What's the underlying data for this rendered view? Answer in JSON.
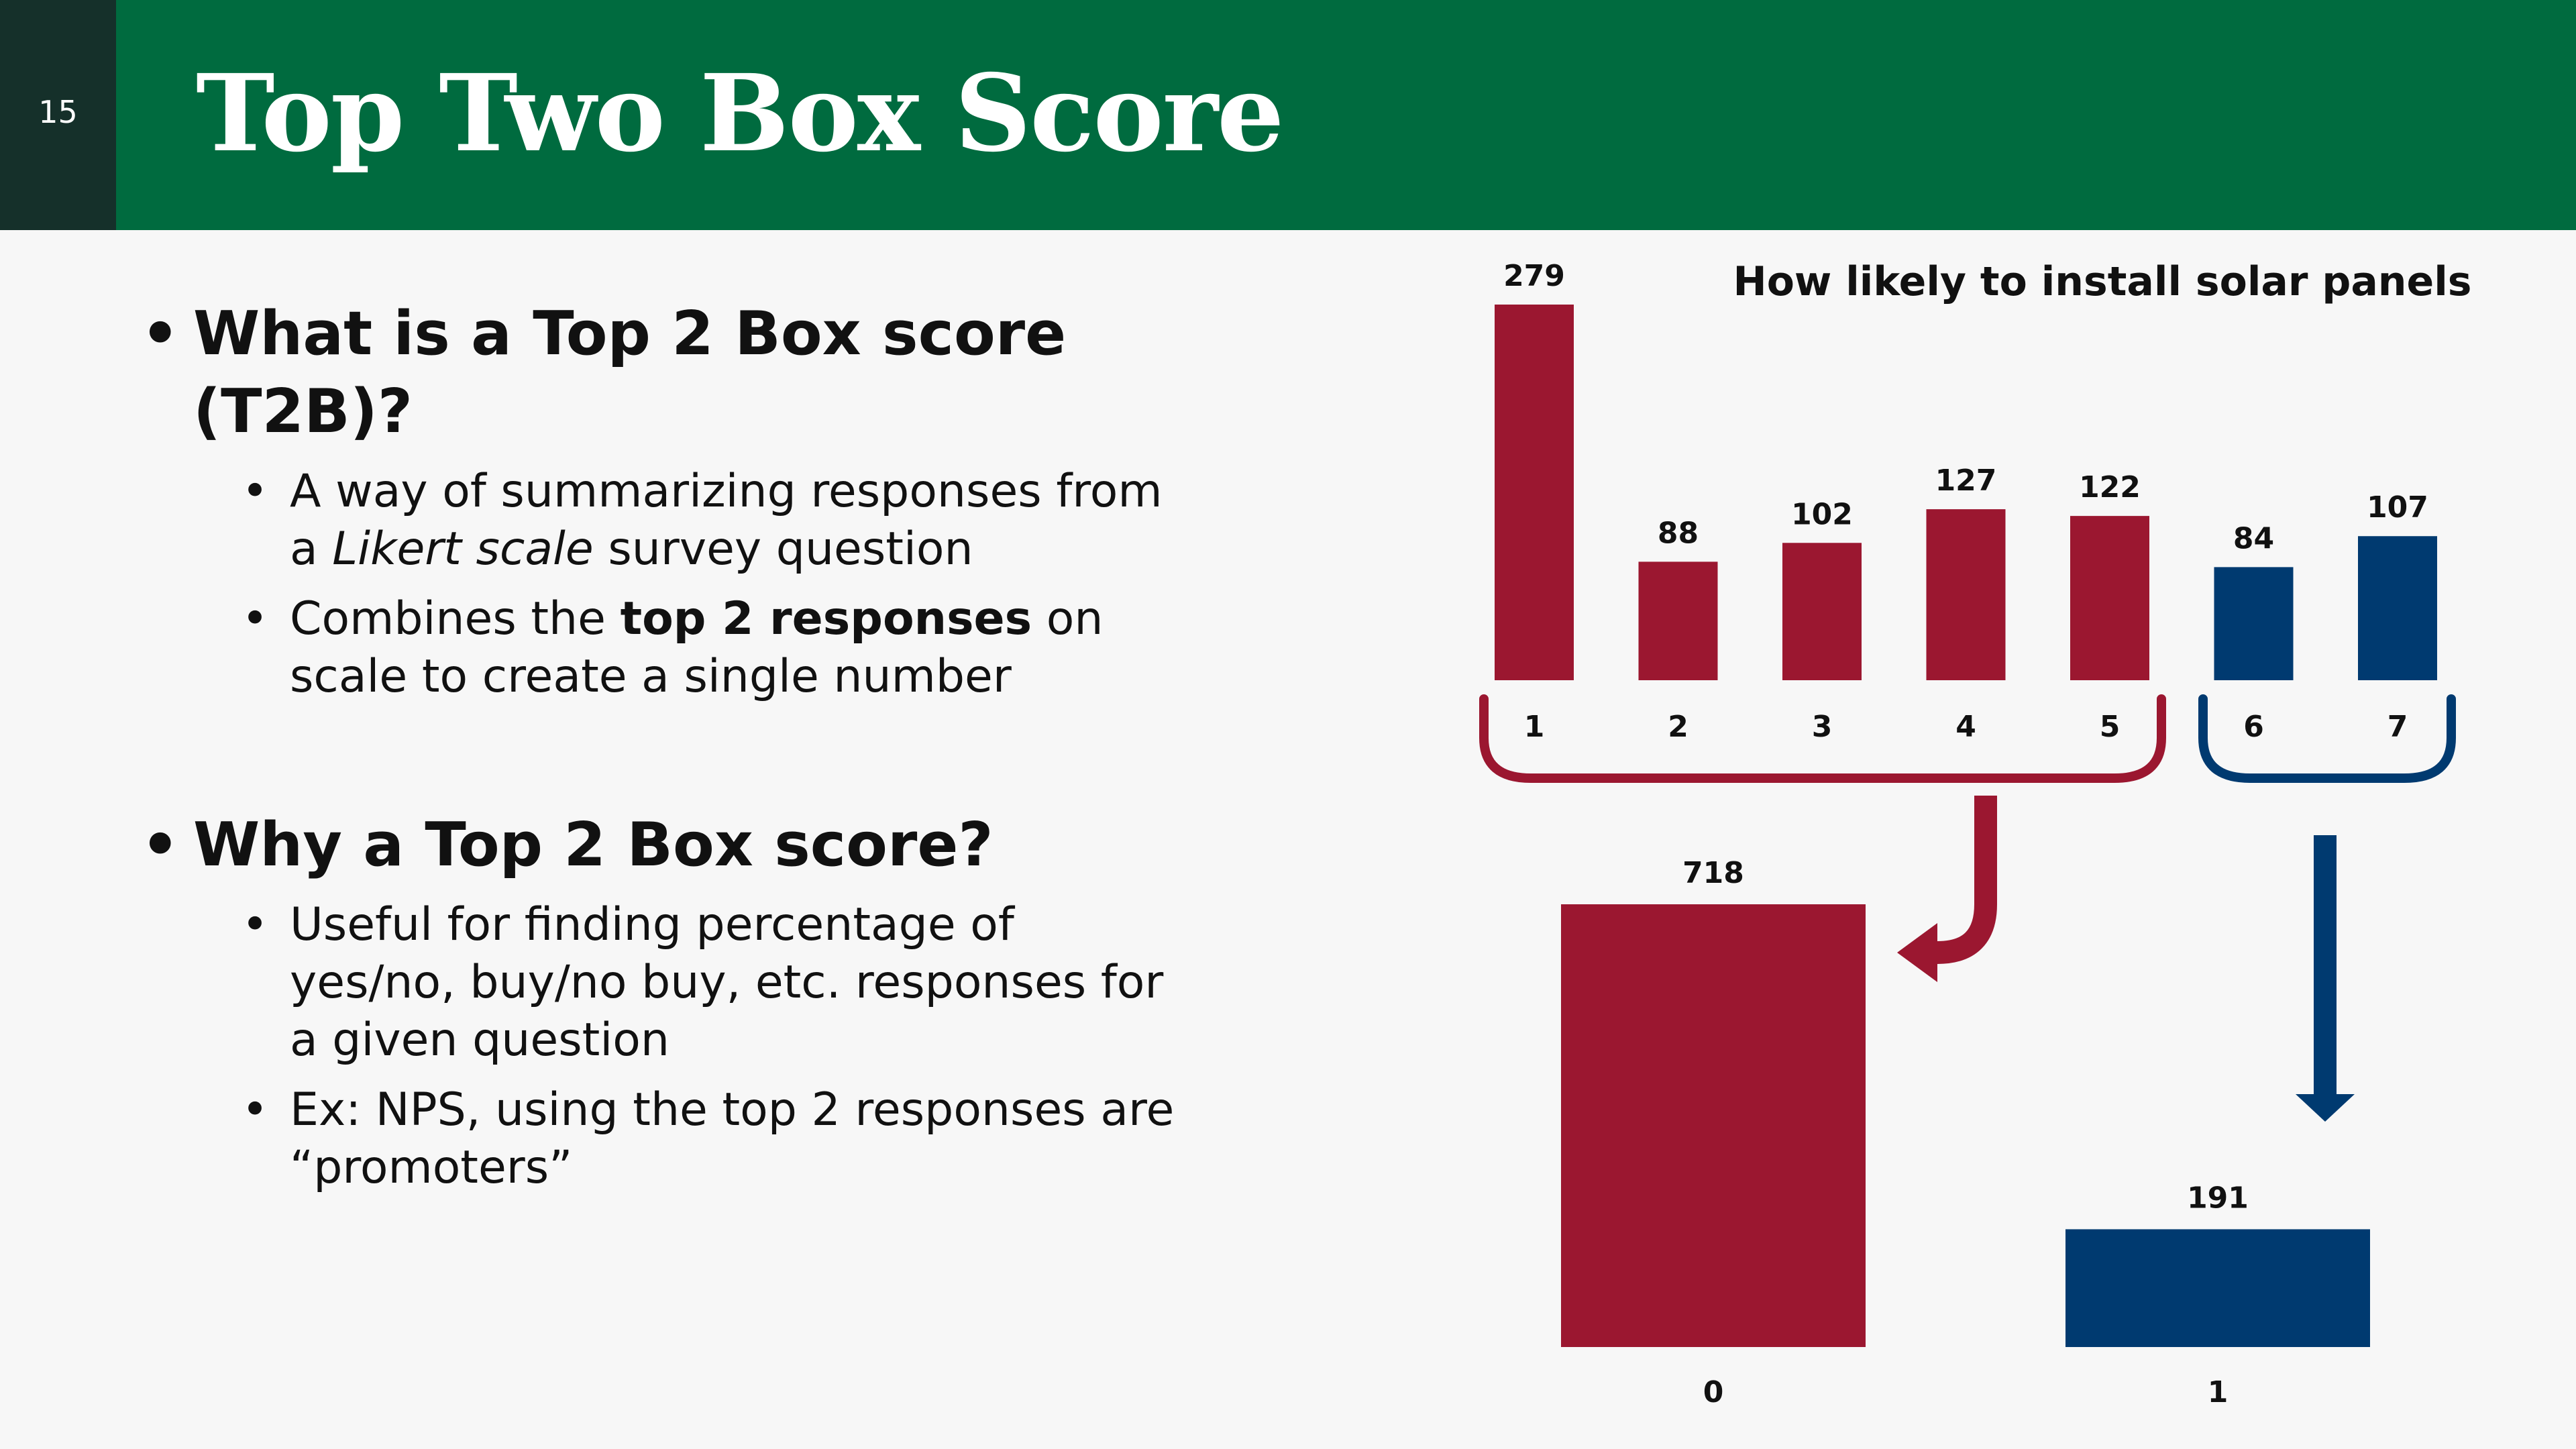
{
  "slide": {
    "number": "15",
    "title": "Top Two Box Score"
  },
  "colors": {
    "header": "#006b3f",
    "badge": "#15302a",
    "red": "#9b1730",
    "blue": "#003a70"
  },
  "bullets": {
    "q1": "What is a Top 2 Box score (T2B)?",
    "q1_items": [
      {
        "pre": "A way of summarizing responses from a ",
        "em": "Likert scale",
        "post": " survey question"
      },
      {
        "pre": "Combines the ",
        "strong": "top 2 responses",
        "post": " on scale to create a single number"
      }
    ],
    "q2": "Why a Top 2 Box score?",
    "q2_items": [
      "Useful for finding percentage of yes/no, buy/no buy, etc. responses for a given question",
      "Ex: NPS, using the top 2 responses are “promoters”"
    ]
  },
  "chart_data": [
    {
      "type": "bar",
      "title": "How likely to install solar panels",
      "categories": [
        "1",
        "2",
        "3",
        "4",
        "5",
        "6",
        "7"
      ],
      "values": [
        279,
        88,
        102,
        127,
        122,
        84,
        107
      ],
      "groups": [
        "0",
        "0",
        "0",
        "0",
        "0",
        "1",
        "1"
      ]
    },
    {
      "type": "bar",
      "categories": [
        "0",
        "1"
      ],
      "values": [
        718,
        191
      ]
    }
  ]
}
